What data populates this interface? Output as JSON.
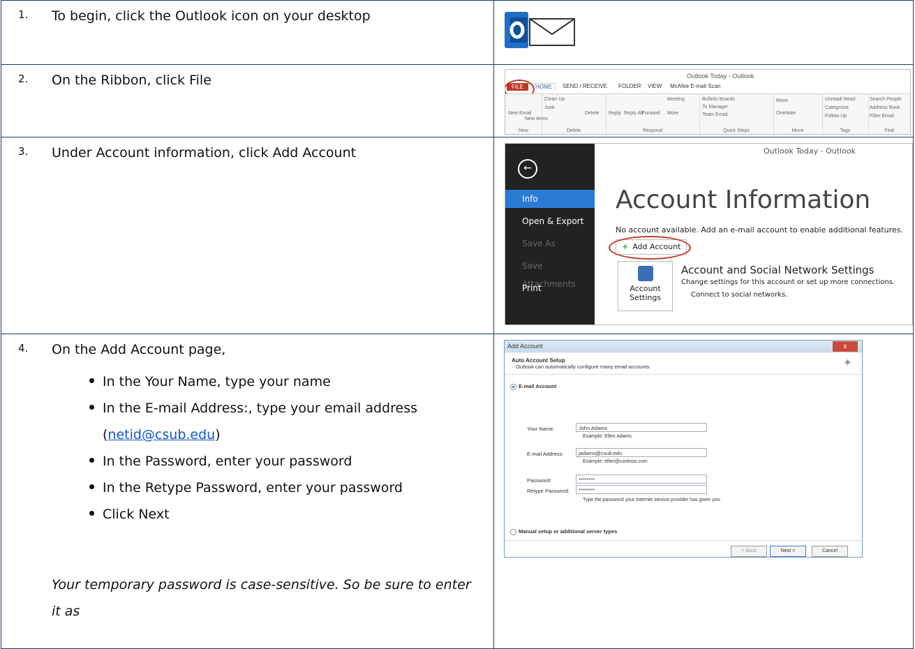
{
  "steps": [
    {
      "num": "1.",
      "text": "To begin, click the Outlook icon on your desktop"
    },
    {
      "num": "2.",
      "text": "On the Ribbon, click File"
    },
    {
      "num": "3.",
      "text": "Under Account information, click Add Account"
    },
    {
      "num": "4.",
      "text": "On the Add Account page,"
    }
  ],
  "step4": {
    "bullets": [
      "In the Your Name, type your name",
      "In the E-mail Address:, type your email address",
      "In the Password, enter your password",
      "In the Retype Password, enter your password",
      "Click Next"
    ],
    "email_link_prefix": "(",
    "email_link": "netid@csub.edu",
    "email_link_suffix": ")",
    "note": "Your temporary password is case-sensitive. So be sure to enter it as"
  },
  "ribbon": {
    "title": "Outlook Today - Outlook",
    "tabs": [
      "FILE",
      "HOME",
      "SEND / RECEIVE",
      "FOLDER",
      "VIEW",
      "McAfee E-mail Scan"
    ],
    "groups": [
      "New",
      "Delete",
      "Respond",
      "Quick Steps",
      "Move",
      "Tags",
      "Find"
    ],
    "items": {
      "new_email": "New Email",
      "new_items": "New Items",
      "clean_up": "Clean Up",
      "junk": "Junk",
      "delete": "Delete",
      "reply": "Reply",
      "reply_all": "Reply All",
      "forward": "Forward",
      "meeting": "Meeting",
      "more": "More",
      "bulletin_boards": "Bulletin Boards",
      "to_manager": "To Manager",
      "team_email": "Team Email",
      "move": "Move",
      "onenote": "OneNote",
      "unread_read": "Unread/ Read",
      "categorize": "Categorize",
      "follow_up": "Follow Up",
      "search_people": "Search People",
      "address_book": "Address Book",
      "filter_email": "Filter Email"
    }
  },
  "backstage": {
    "title_bar": "Outlook Today - Outlook",
    "menu": [
      "Info",
      "Open & Export",
      "Save As",
      "Save Attachments",
      "Print"
    ],
    "heading": "Account Information",
    "no_account": "No account available. Add an e-mail account to enable additional features.",
    "add_account": "Add Account",
    "settings_btn": "Account Settings",
    "settings_heading": "Account and Social Network Settings",
    "settings_desc": "Change settings for this account or set up more connections.",
    "settings_link": "Connect to social networks."
  },
  "dialog": {
    "title": "Add Account",
    "header": "Auto Account Setup",
    "subheader": "Outlook can automatically configure many email accounts.",
    "option_email": "E-mail Account",
    "your_name_label": "Your Name:",
    "your_name_value": "John Adams",
    "your_name_example": "Example: Ellen Adams",
    "email_label": "E-mail Address:",
    "email_value": "jadams@csub.edu",
    "email_example": "Example: ellen@contoso.com",
    "password_label": "Password:",
    "password_value": "********",
    "retype_label": "Retype Password:",
    "retype_value": "********",
    "password_hint": "Type the password your Internet service provider has given you.",
    "option_manual": "Manual setup or additional server types",
    "btn_back": "< Back",
    "btn_next": "Next >",
    "btn_cancel": "Cancel",
    "close": "x"
  },
  "colors": {
    "border": "#1f3864",
    "accent_red": "#c0392b",
    "outlook_blue": "#1e6fc6",
    "link": "#1155cc"
  }
}
